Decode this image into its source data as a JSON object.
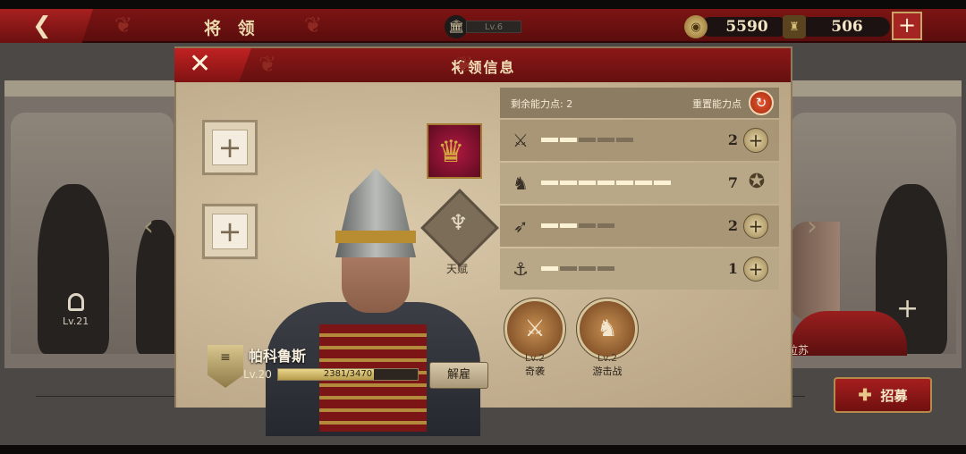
{
  "top_bar": {
    "back_icon": "left-arrow-icon",
    "title": "将 领",
    "city_level": "Lv.6",
    "coins": "5590",
    "gems": "506",
    "add_icon": "plus-icon"
  },
  "background": {
    "left_slot_level": "Lv.21",
    "right_general_name": "拉苏",
    "recruit_label": "招募"
  },
  "dialog": {
    "title": "将领信息",
    "talent_label": "天赋",
    "general": {
      "name": "帕科鲁斯",
      "level": "Lv.20",
      "xp": "2381/3470",
      "xp_fraction": 0.686
    },
    "dismiss_label": "解雇",
    "points_label": "剩余能力点: 2",
    "reset_label": "重置能力点",
    "stats": [
      {
        "icon": "sword-icon",
        "value": "2",
        "pips_on": 2,
        "pips_total": 5
      },
      {
        "icon": "horse-icon",
        "value": "7",
        "pips_on": 7,
        "pips_total": 7,
        "maxed": true
      },
      {
        "icon": "bow-icon",
        "value": "2",
        "pips_on": 2,
        "pips_total": 4
      },
      {
        "icon": "anchor-icon",
        "value": "1",
        "pips_on": 1,
        "pips_total": 4
      }
    ],
    "skills": [
      {
        "level": "Lv.2",
        "name": "奇袭"
      },
      {
        "level": "Lv.2",
        "name": "游击战"
      }
    ]
  }
}
